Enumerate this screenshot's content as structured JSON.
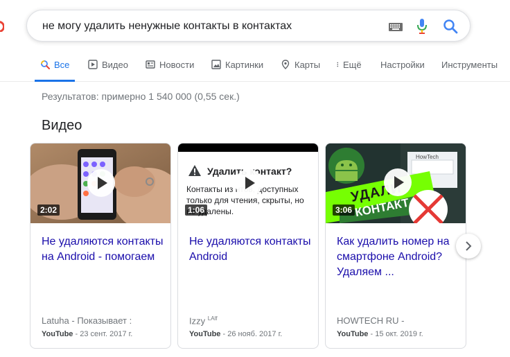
{
  "search": {
    "query": "не могу удалить ненужные контакты в контактах"
  },
  "tabs": [
    {
      "label": "Все",
      "icon": "search-icon"
    },
    {
      "label": "Видео",
      "icon": "play-icon"
    },
    {
      "label": "Новости",
      "icon": "news-icon"
    },
    {
      "label": "Картинки",
      "icon": "image-icon"
    },
    {
      "label": "Карты",
      "icon": "map-pin-icon"
    },
    {
      "label": "Ещё",
      "icon": "more-icon"
    },
    {
      "label": "Настройки"
    },
    {
      "label": "Инструменты"
    }
  ],
  "stats": "Результатов: примерно 1 540 000 (0,55 сек.)",
  "section_title": "Видео",
  "videos": [
    {
      "duration": "2:02",
      "title": "Не удаляются контакты на Android - помогаем",
      "source": "Latuha - Показывает :",
      "platform": "YouTube",
      "date": " - 23 сент. 2017 г."
    },
    {
      "duration": "1:06",
      "title": "Не удаляются контакты Android",
      "source": "Izzy",
      "source_sup": "LAlf",
      "platform": "YouTube",
      "date": " - 26 нояб. 2017 г.",
      "thumb_heading": "Удалить контакт?",
      "thumb_text": "Контакты из  нтов, доступных только для чтения, скрыты, но не удалены."
    },
    {
      "duration": "3:06",
      "title": "Как удалить номер на смартфоне Android? Удаляем ...",
      "source": "HOWTECH RU -",
      "platform": "YouTube",
      "date": " - 15 окт. 2019 г.",
      "thumb_banner_1": "УДАЛИ",
      "thumb_banner_2": "КОНТАКТ",
      "thumb_brand": "HowTech"
    }
  ],
  "colors": {
    "link": "#1a0dab",
    "accent": "#1a73e8",
    "muted": "#70757a"
  }
}
